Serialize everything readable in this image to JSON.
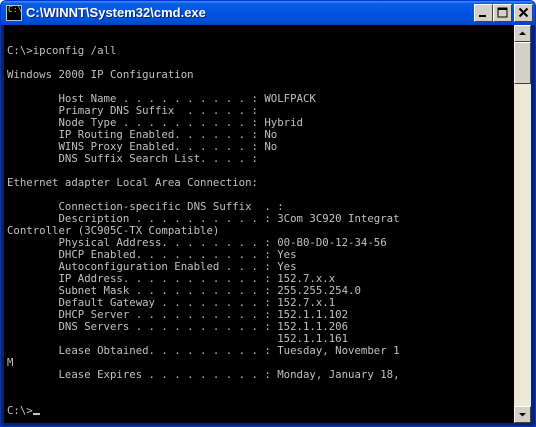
{
  "window": {
    "title": "C:\\WINNT\\System32\\cmd.exe"
  },
  "console": {
    "lines": [
      "",
      "C:\\>ipconfig /all",
      "",
      "Windows 2000 IP Configuration",
      "",
      "        Host Name . . . . . . . . . . : WOLFPACK",
      "        Primary DNS Suffix  . . . . . :",
      "        Node Type . . . . . . . . . . : Hybrid",
      "        IP Routing Enabled. . . . . . : No",
      "        WINS Proxy Enabled. . . . . . : No",
      "        DNS Suffix Search List. . . . :",
      "",
      "Ethernet adapter Local Area Connection:",
      "",
      "        Connection-specific DNS Suffix  . :",
      "        Description . . . . . . . . . . : 3Com 3C920 Integrat",
      "Controller (3C905C-TX Compatible)",
      "        Physical Address. . . . . . . . : 00-B0-D0-12-34-56",
      "        DHCP Enabled. . . . . . . . . . : Yes",
      "        Autoconfiguration Enabled . . . : Yes",
      "        IP Address. . . . . . . . . . . : 152.7.x.x",
      "        Subnet Mask . . . . . . . . . . : 255.255.254.0",
      "        Default Gateway . . . . . . . . : 152.7.x.1",
      "        DHCP Server . . . . . . . . . . : 152.1.1.102",
      "        DNS Servers . . . . . . . . . . : 152.1.1.206",
      "                                          152.1.1.161",
      "        Lease Obtained. . . . . . . . . : Tuesday, November 1",
      "M",
      "        Lease Expires . . . . . . . . . : Monday, January 18,",
      "",
      "",
      "C:\\>"
    ]
  },
  "colors": {
    "console_background": "#000000",
    "console_text": "#c0c0c0",
    "titlebar": "#0054e3",
    "title_text": "#ffffff"
  },
  "icons": {
    "window": "console-icon",
    "minimize": "minimize-icon",
    "maximize": "maximize-icon",
    "close": "close-icon",
    "scroll_up": "scroll-up-arrow-icon",
    "scroll_down": "scroll-down-arrow-icon"
  }
}
